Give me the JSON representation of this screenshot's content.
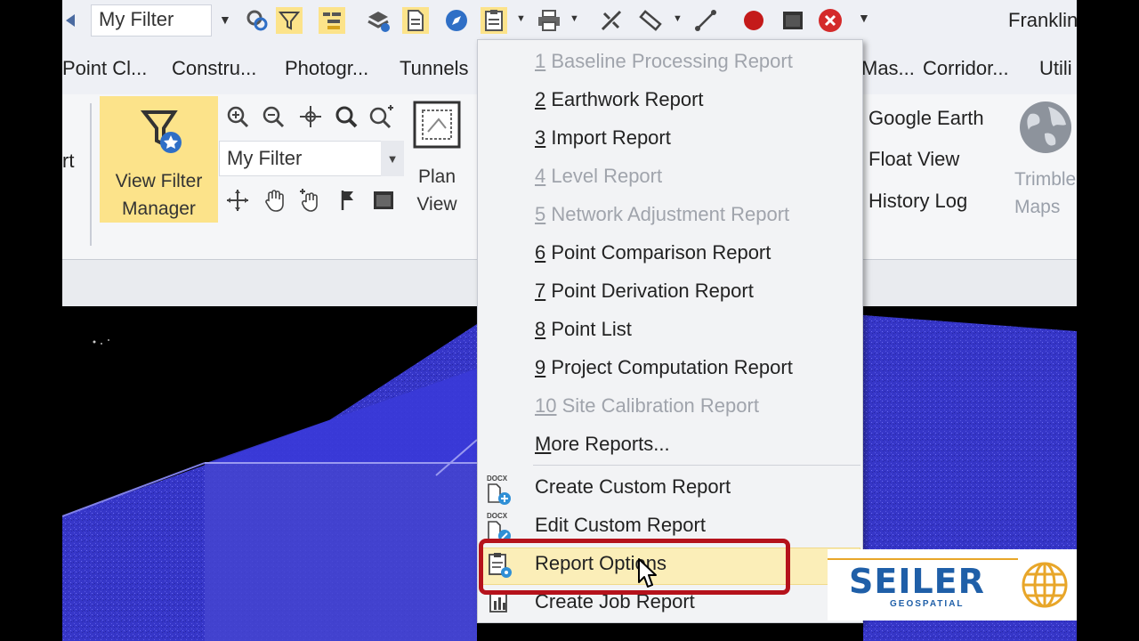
{
  "toolbar": {
    "filter_value": "My Filter",
    "user_label": "Franklin"
  },
  "tabs": [
    "Point Cl...",
    "Constru...",
    "Photogr...",
    "Tunnels",
    "Mas...",
    "Corridor...",
    "Utili"
  ],
  "ribbon": {
    "left_cut_label": "rt",
    "view_filter_manager": "View Filter Manager",
    "view_filter_line1": "View Filter",
    "view_filter_line2": "Manager",
    "filter_combo": "My Filter",
    "plan_line1": "Plan",
    "plan_line2": "View",
    "google_earth": "Google Earth",
    "float_view": "Float View",
    "history_log": "History Log",
    "trimble_line1": "Trimble",
    "trimble_line2": "Maps"
  },
  "menu": {
    "items": [
      {
        "num": "1",
        "label": " Baseline Processing Report",
        "enabled": false
      },
      {
        "num": "2",
        "label": " Earthwork Report",
        "enabled": true
      },
      {
        "num": "3",
        "label": " Import Report",
        "enabled": true
      },
      {
        "num": "4",
        "label": " Level Report",
        "enabled": false
      },
      {
        "num": "5",
        "label": " Network Adjustment Report",
        "enabled": false
      },
      {
        "num": "6",
        "label": " Point Comparison Report",
        "enabled": true
      },
      {
        "num": "7",
        "label": " Point Derivation Report",
        "enabled": true
      },
      {
        "num": "8",
        "label": " Point List",
        "enabled": true
      },
      {
        "num": "9",
        "label": " Project Computation Report",
        "enabled": true
      },
      {
        "num": "10",
        "label": " Site Calibration Report",
        "enabled": false
      }
    ],
    "more_m": "M",
    "more_rest": "ore Reports...",
    "create_custom": "Create Custom Report",
    "edit_custom": "Edit Custom Report",
    "report_options": "Report Options",
    "create_job": "Create Job Report",
    "docx_tag": "DOCX"
  },
  "logo": {
    "word": "SEILER",
    "sub": "GEOSPATIAL"
  },
  "colors": {
    "highlight": "#fce38a",
    "accent_red": "#b5121b",
    "point_cloud": "#3a3ad0",
    "brand_blue": "#1f5fa8"
  }
}
